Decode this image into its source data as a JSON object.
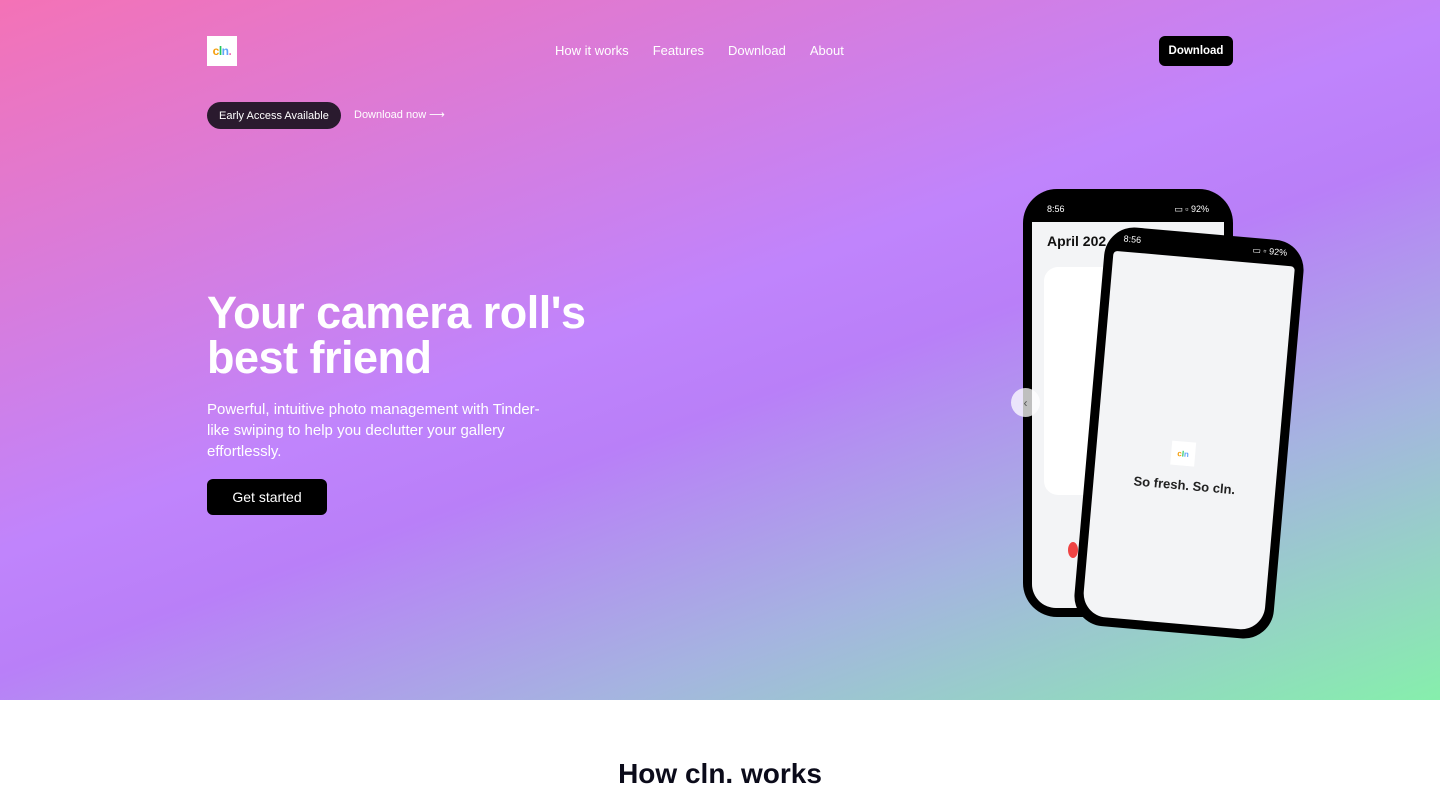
{
  "brand": {
    "logo_parts": [
      "c",
      "l",
      "n",
      "."
    ]
  },
  "nav": {
    "items": [
      "How it works",
      "Features",
      "Download",
      "About"
    ],
    "download_label": "Download"
  },
  "announcement": {
    "pill": "Early Access Available",
    "link": "Download now",
    "arrow": "⟶"
  },
  "hero": {
    "headline_line1": "Your camera roll's",
    "headline_line2": "best friend",
    "subtext": "Powerful, intuitive photo management with Tinder-like swiping to help you declutter your gallery effortlessly.",
    "cta": "Get started"
  },
  "phone_back": {
    "time": "8:56",
    "battery": "92%",
    "month": "April 202"
  },
  "phone_front": {
    "time": "8:56",
    "battery": "92%",
    "tagline": "So fresh. So cln."
  },
  "carousel": {
    "prev_glyph": "‹"
  },
  "section": {
    "title": "How cln. works"
  },
  "colors": {
    "primary": "#000000",
    "hero_start": "#f472b6",
    "hero_mid": "#c084fc",
    "hero_end": "#86efac"
  }
}
